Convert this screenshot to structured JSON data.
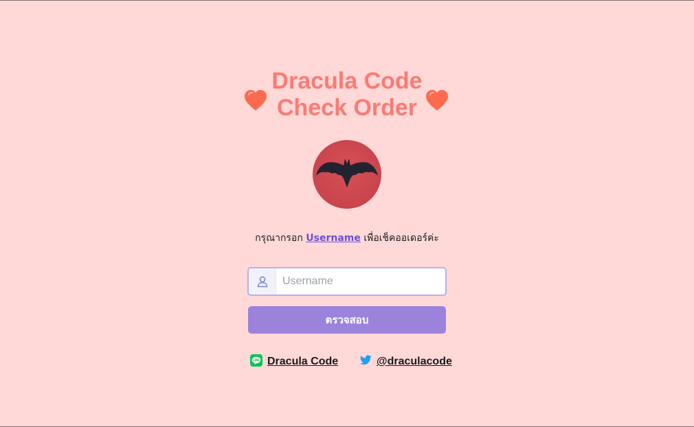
{
  "header": {
    "title_line1": "Dracula Code",
    "title_line2": "Check Order"
  },
  "icons": {
    "hearts": "heart-icon",
    "logo": "bat-logo",
    "user": "user-icon",
    "line": "line-icon",
    "twitter": "twitter-icon"
  },
  "instruction": {
    "prefix": "กรุณากรอก",
    "link": "Username",
    "suffix": "เพื่อเช็คออเดอร์ค่ะ"
  },
  "form": {
    "username_placeholder": "Username",
    "username_value": "",
    "submit_label": "ตรวจสอบ"
  },
  "social": {
    "line_label": "Dracula Code",
    "twitter_label": "@draculacode"
  },
  "colors": {
    "background": "#ffd8d8",
    "title": "#fb7b74",
    "heart": "#fd6b4f",
    "logo_bg": "#c9444c",
    "link": "#6a4fd9",
    "button": "#9b83dc",
    "input_border": "#b4b0ef",
    "line_green": "#06c755",
    "twitter_blue": "#1da1f2"
  }
}
